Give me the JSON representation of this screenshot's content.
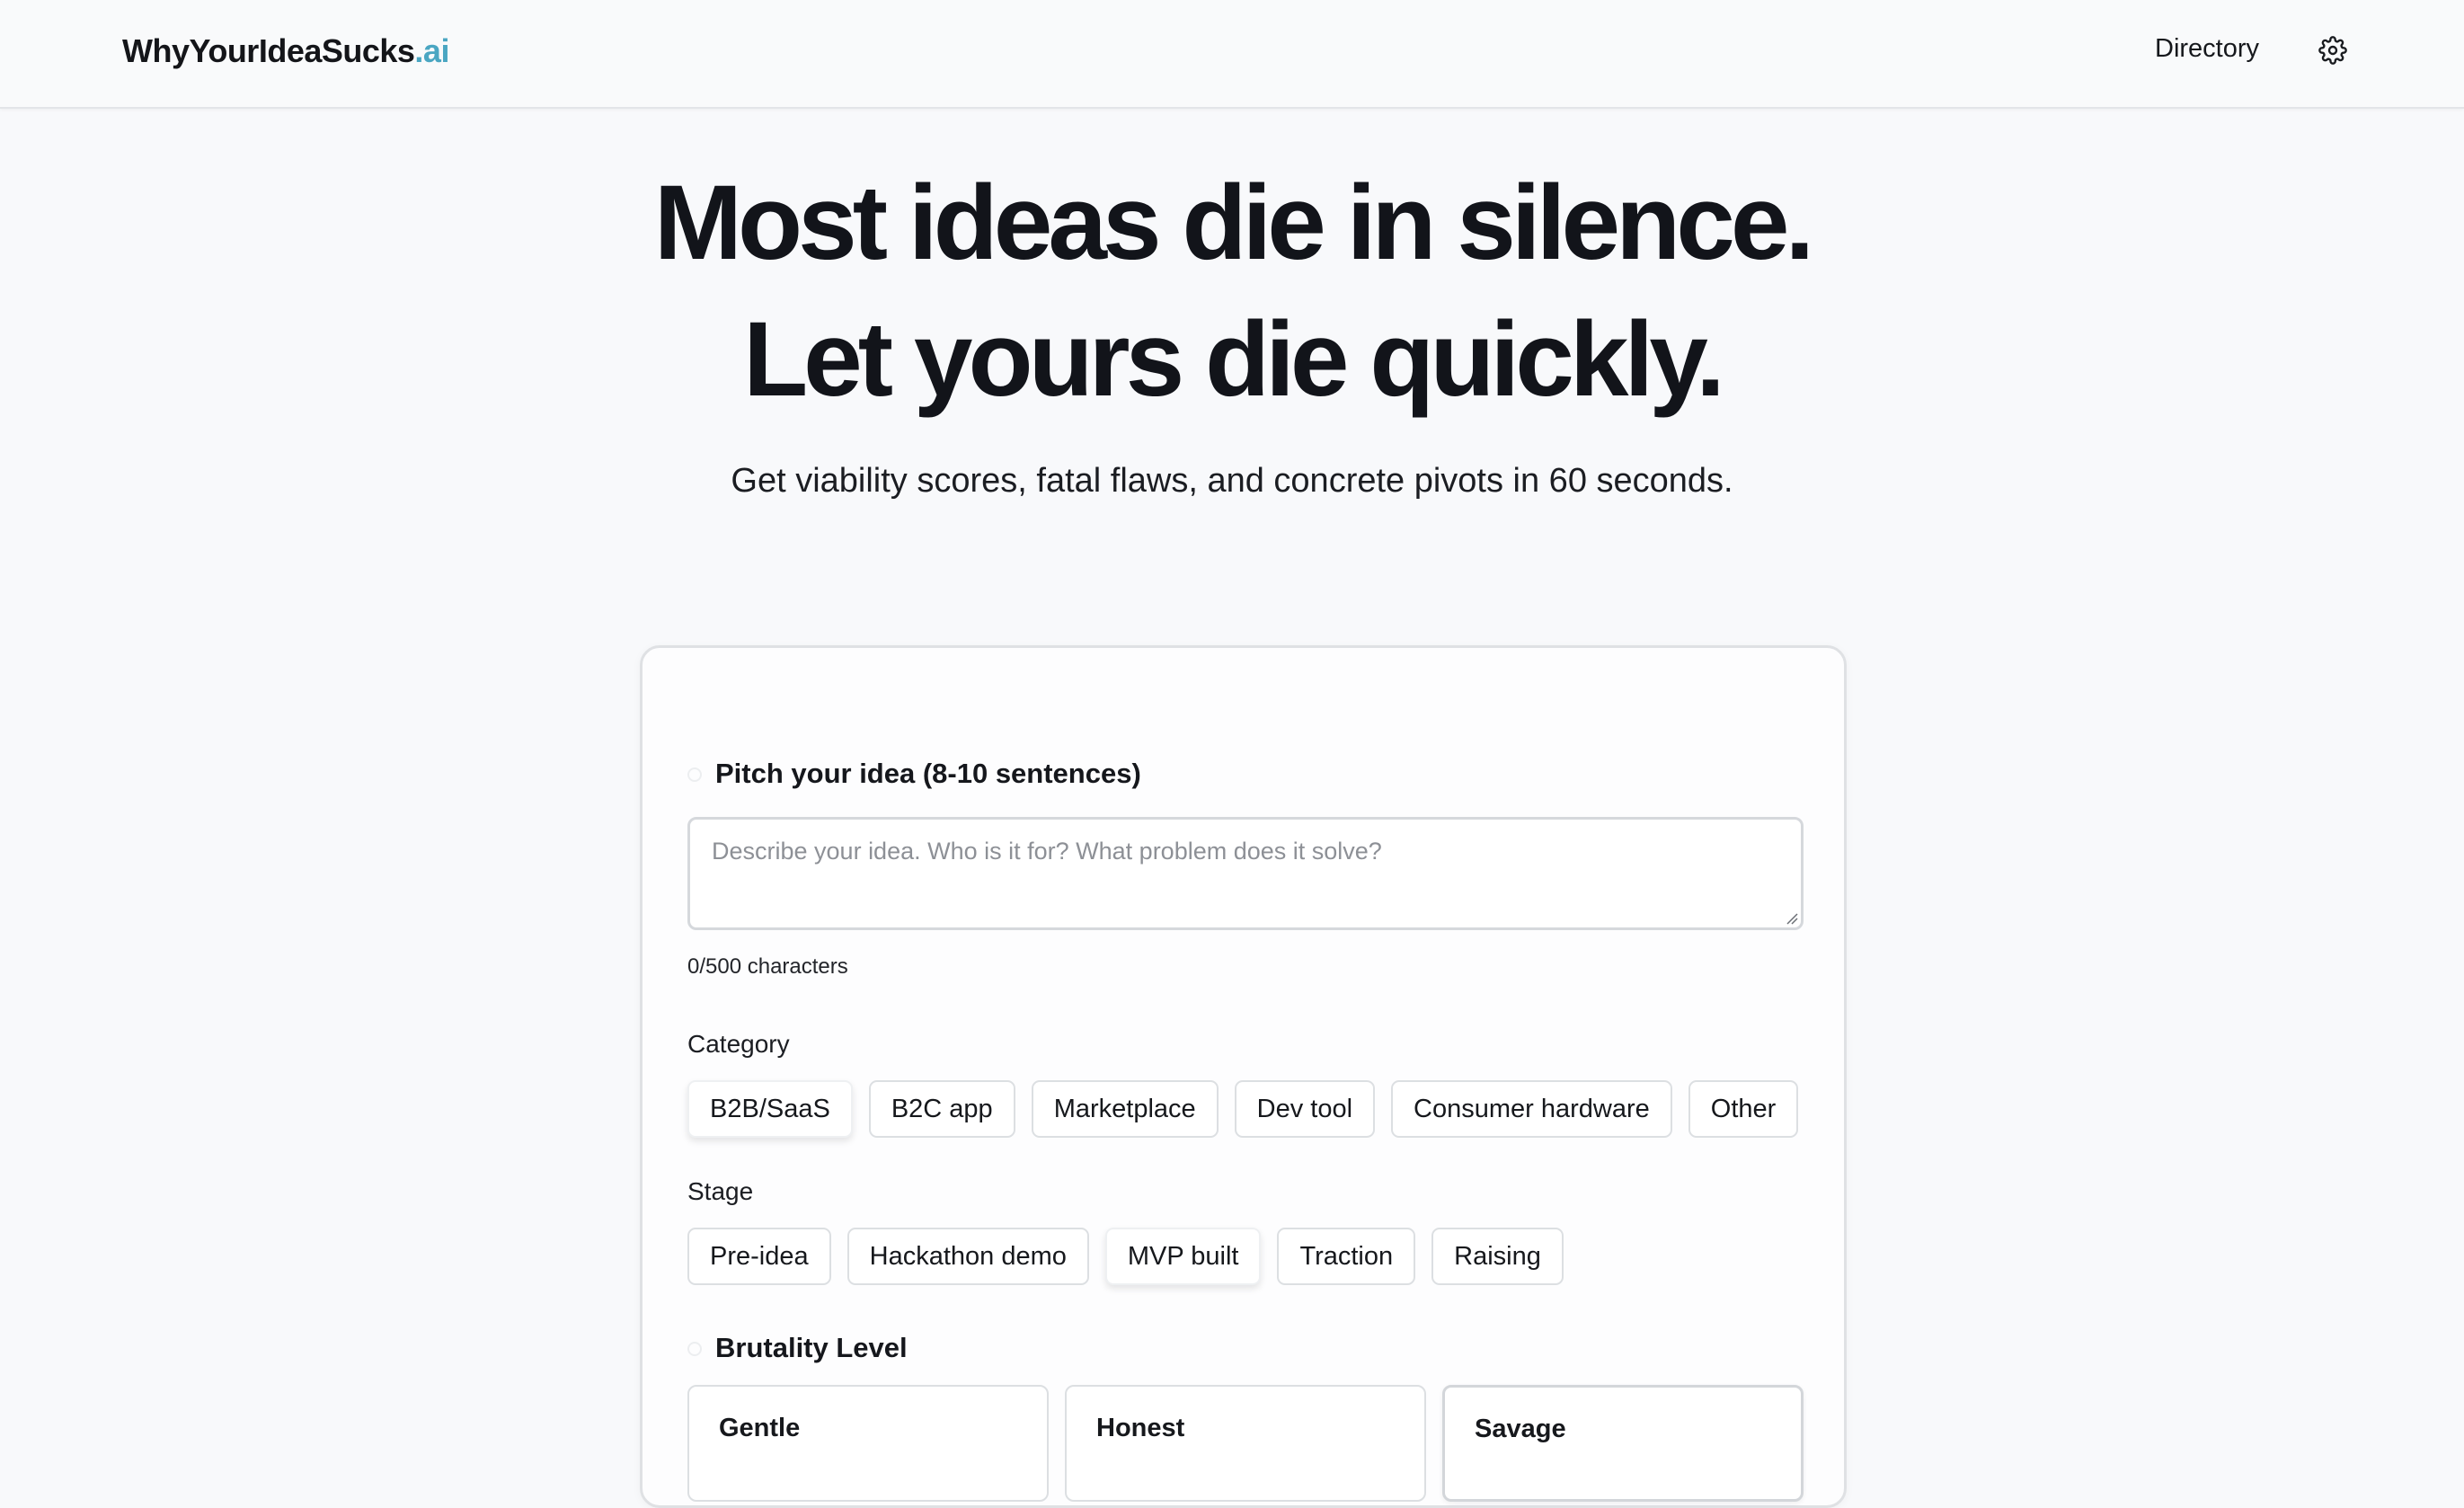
{
  "header": {
    "logo_main": "WhyYourIdeaSucks",
    "logo_tld": ".ai",
    "nav_directory": "Directory",
    "settings_icon": "gear-icon"
  },
  "hero": {
    "title_line1": "Most ideas die in silence.",
    "title_line2": "Let yours die quickly.",
    "subtitle": "Get viability scores, fatal flaws, and concrete pivots in 60 seconds."
  },
  "form": {
    "pitch_title": "Pitch your idea (8-10 sentences)",
    "pitch_value": "",
    "pitch_placeholder": "Describe your idea. Who is it for? What problem does it solve?",
    "char_counter": "0/500 characters",
    "category_label": "Category",
    "categories": [
      "B2B/SaaS",
      "B2C app",
      "Marketplace",
      "Dev tool",
      "Consumer hardware",
      "Other"
    ],
    "category_selected": "B2B/SaaS",
    "stage_label": "Stage",
    "stages": [
      "Pre-idea",
      "Hackathon demo",
      "MVP built",
      "Traction",
      "Raising"
    ],
    "stage_selected": "MVP built",
    "brutality_title": "Brutality Level",
    "levels": [
      "Gentle",
      "Honest",
      "Savage"
    ],
    "level_selected": "Savage"
  },
  "colors": {
    "accent_tld": "#4aa6c2",
    "text": "#12141a",
    "background": "#f8f9fb"
  }
}
